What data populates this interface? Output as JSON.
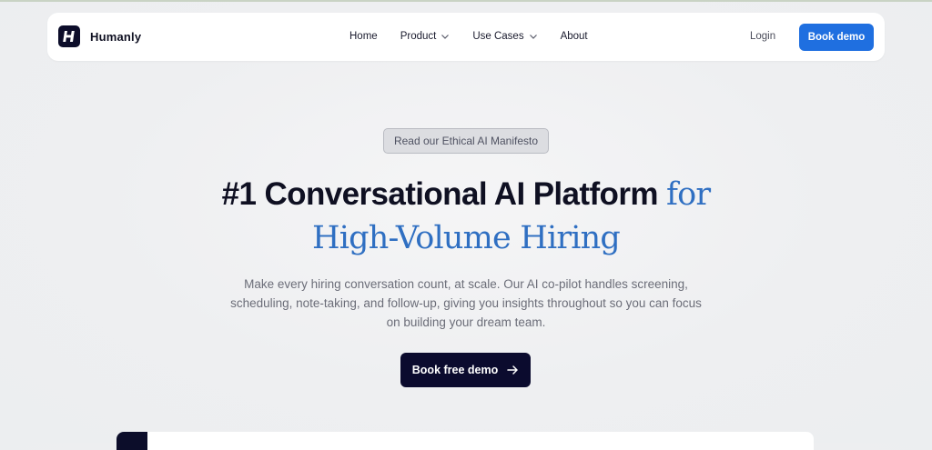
{
  "brand": {
    "name": "Humanly"
  },
  "nav": {
    "items": [
      {
        "label": "Home",
        "has_dropdown": false
      },
      {
        "label": "Product",
        "has_dropdown": true
      },
      {
        "label": "Use Cases",
        "has_dropdown": true
      },
      {
        "label": "About",
        "has_dropdown": false
      }
    ],
    "login_label": "Login",
    "cta_label": "Book demo"
  },
  "hero": {
    "badge": "Read our Ethical AI Manifesto",
    "headline_main": "#1 Conversational AI Platform",
    "headline_accent_1": "for",
    "headline_accent_2": "High-Volume Hiring",
    "subtitle": "Make every hiring conversation count, at scale. Our AI co-pilot handles screening, scheduling, note-taking, and follow-up, giving you insights throughout so you can focus on building your dream team.",
    "cta_label": "Book free demo"
  },
  "colors": {
    "primary_button": "#1f6fe0",
    "accent_text": "#2f6fc2",
    "dark_navy": "#0b0b2e",
    "page_background": "#eeeff1"
  },
  "icons": {
    "logo": "h-logo-icon",
    "dropdown": "chevron-down-icon",
    "cta": "arrow-right-icon"
  }
}
